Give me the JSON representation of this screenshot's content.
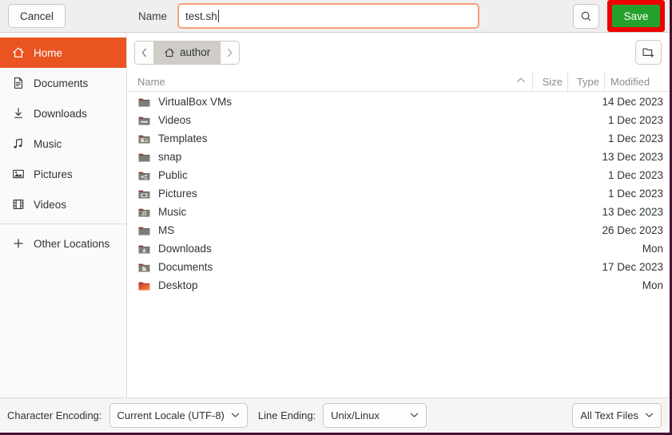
{
  "header": {
    "cancel_label": "Cancel",
    "name_label": "Name",
    "name_value": "test.sh",
    "search_icon": "search-icon",
    "save_label": "Save",
    "save_highlight_color": "#ee0000",
    "save_bg_color": "#26a02c",
    "entry_focus_color": "#f3a07b"
  },
  "sidebar": {
    "accent_color": "#e95420",
    "items": [
      {
        "label": "Home",
        "icon": "home-icon",
        "active": true
      },
      {
        "label": "Documents",
        "icon": "document-icon",
        "active": false
      },
      {
        "label": "Downloads",
        "icon": "download-icon",
        "active": false
      },
      {
        "label": "Music",
        "icon": "music-note-icon",
        "active": false
      },
      {
        "label": "Pictures",
        "icon": "image-icon",
        "active": false
      },
      {
        "label": "Videos",
        "icon": "film-icon",
        "active": false
      }
    ],
    "other": {
      "label": "Other Locations",
      "icon": "plus-icon"
    }
  },
  "pathbar": {
    "back_icon": "chevron-left-icon",
    "forward_icon": "chevron-right-icon",
    "crumb_label": "author",
    "crumb_icon": "home-icon",
    "new_folder_icon": "new-folder-icon"
  },
  "columns": {
    "name": "Name",
    "size": "Size",
    "type": "Type",
    "modified": "Modified",
    "sort_indicator": "⌃"
  },
  "files": [
    {
      "name": "VirtualBox VMs",
      "size": "",
      "type": "",
      "modified": "14 Dec 2023",
      "icon": "folder-plain-icon"
    },
    {
      "name": "Videos",
      "size": "",
      "type": "",
      "modified": "1 Dec 2023",
      "icon": "folder-videos-icon"
    },
    {
      "name": "Templates",
      "size": "",
      "type": "",
      "modified": "1 Dec 2023",
      "icon": "folder-templates-icon"
    },
    {
      "name": "snap",
      "size": "",
      "type": "",
      "modified": "13 Dec 2023",
      "icon": "folder-plain-icon"
    },
    {
      "name": "Public",
      "size": "",
      "type": "",
      "modified": "1 Dec 2023",
      "icon": "folder-public-icon"
    },
    {
      "name": "Pictures",
      "size": "",
      "type": "",
      "modified": "1 Dec 2023",
      "icon": "folder-pictures-icon"
    },
    {
      "name": "Music",
      "size": "",
      "type": "",
      "modified": "13 Dec 2023",
      "icon": "folder-music-icon"
    },
    {
      "name": "MS",
      "size": "",
      "type": "",
      "modified": "26 Dec 2023",
      "icon": "folder-plain-icon"
    },
    {
      "name": "Downloads",
      "size": "",
      "type": "",
      "modified": "Mon",
      "icon": "folder-downloads-icon"
    },
    {
      "name": "Documents",
      "size": "",
      "type": "",
      "modified": "17 Dec 2023",
      "icon": "folder-documents-icon"
    },
    {
      "name": "Desktop",
      "size": "",
      "type": "",
      "modified": "Mon",
      "icon": "folder-desktop-icon"
    }
  ],
  "footer": {
    "encoding_label": "Character Encoding:",
    "encoding_value": "Current Locale (UTF-8)",
    "line_ending_label": "Line Ending:",
    "line_ending_value": "Unix/Linux",
    "filter_value": "All Text Files",
    "chevron_icon": "chevron-down-icon"
  }
}
